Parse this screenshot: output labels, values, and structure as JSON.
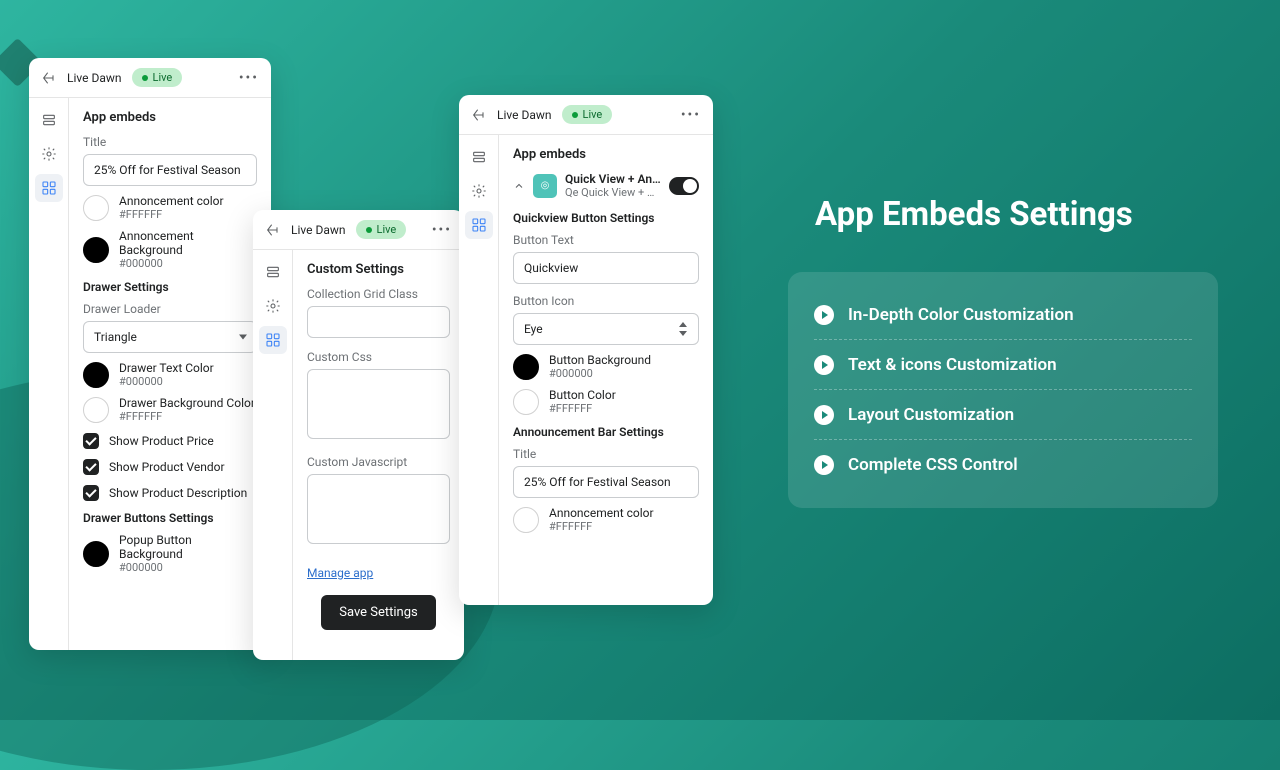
{
  "promo": {
    "title": "App Embeds Settings",
    "features": [
      "In-Depth Color Customization",
      "Text & icons Customization",
      "Layout Customization",
      "Complete CSS Control"
    ]
  },
  "panel1": {
    "header": {
      "title": "Live Dawn",
      "status": "Live"
    },
    "section": "App embeds",
    "title_label": "Title",
    "title_value": "25% Off for Festival Season",
    "colors": {
      "announcement": {
        "label": "Annoncement color",
        "hex": "#FFFFFF"
      },
      "announcement_bg": {
        "label": "Annoncement Background",
        "hex": "#000000"
      },
      "drawer_text": {
        "label": "Drawer Text Color",
        "hex": "#000000"
      },
      "drawer_bg": {
        "label": "Drawer Background Color",
        "hex": "#FFFFFF"
      },
      "popup_btn_bg": {
        "label": "Popup Button Background",
        "hex": "#000000"
      }
    },
    "drawer_section": "Drawer Settings",
    "drawer_loader_label": "Drawer Loader",
    "drawer_loader_value": "Triangle",
    "checks": {
      "price": "Show Product Price",
      "vendor": "Show Product Vendor",
      "desc": "Show Product Description"
    },
    "drawer_buttons_section": "Drawer Buttons Settings"
  },
  "panel2": {
    "header": {
      "title": "Live Dawn",
      "status": "Live"
    },
    "section": "Custom Settings",
    "grid_label": "Collection Grid Class",
    "grid_value": "",
    "css_label": "Custom Css",
    "js_label": "Custom Javascript",
    "manage_link": "Manage app",
    "save_btn": "Save Settings"
  },
  "panel3": {
    "header": {
      "title": "Live Dawn",
      "status": "Live"
    },
    "section": "App embeds",
    "embed": {
      "name": "Quick View + Annou...",
      "sub": "Qe Quick View + Ann..."
    },
    "qv_section": "Quickview Button Settings",
    "btn_text_label": "Button Text",
    "btn_text_value": "Quickview",
    "btn_icon_label": "Button Icon",
    "btn_icon_value": "Eye",
    "colors": {
      "btn_bg": {
        "label": "Button Background",
        "hex": "#000000"
      },
      "btn_color": {
        "label": "Button Color",
        "hex": "#FFFFFF"
      },
      "ann_color": {
        "label": "Annoncement color",
        "hex": "#FFFFFF"
      }
    },
    "ann_section": "Announcement Bar Settings",
    "ann_title_label": "Title",
    "ann_title_value": "25% Off for Festival Season"
  }
}
